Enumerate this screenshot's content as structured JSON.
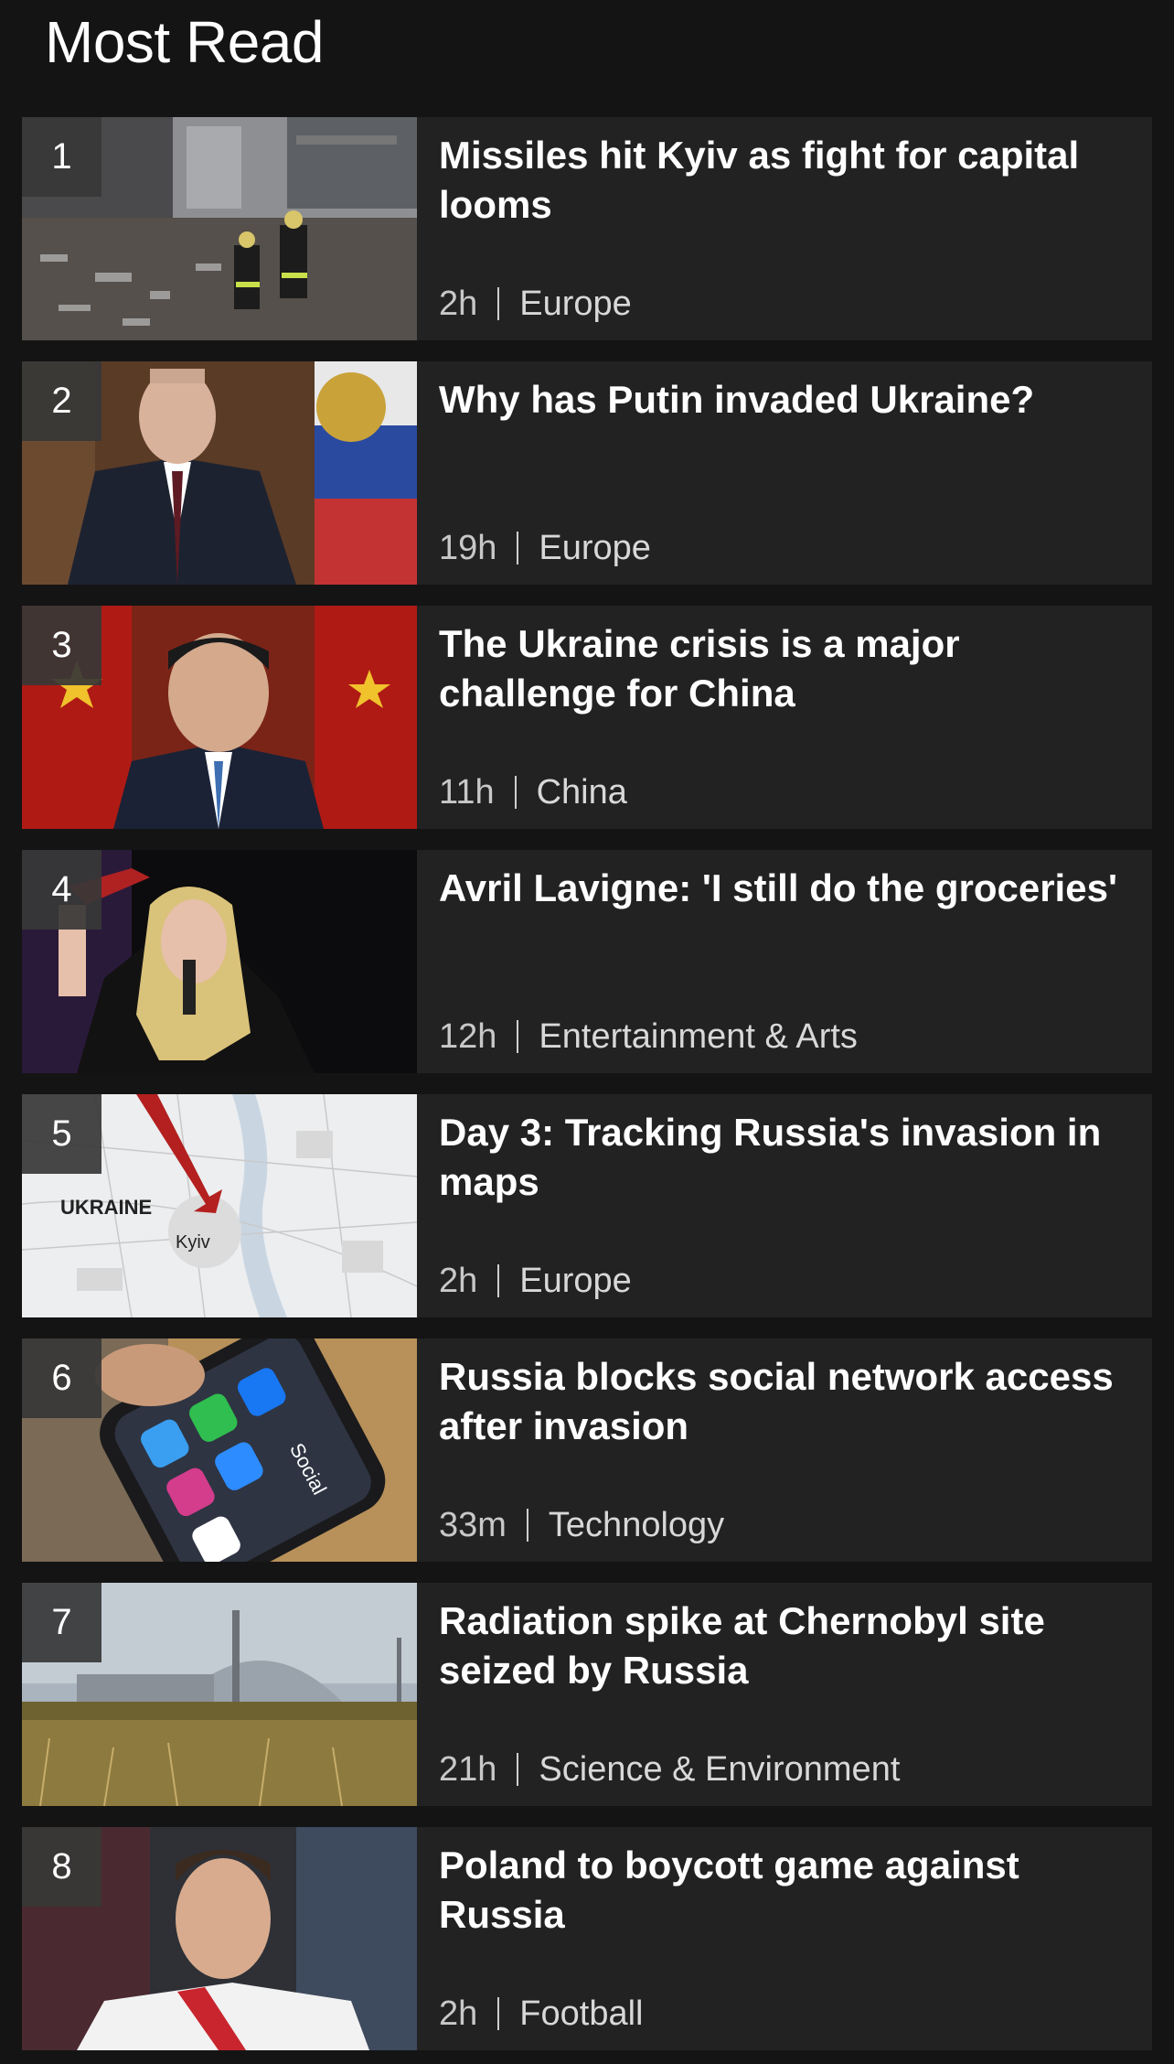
{
  "section": {
    "title": "Most Read"
  },
  "items": [
    {
      "rank": "1",
      "headline": "Missiles hit Kyiv as fight for capital looms",
      "time": "2h",
      "category": "Europe",
      "image": "firefighters-rubble"
    },
    {
      "rank": "2",
      "headline": "Why has Putin invaded Ukraine?",
      "time": "19h",
      "category": "Europe",
      "image": "putin-portrait"
    },
    {
      "rank": "3",
      "headline": "The Ukraine crisis is a major challenge for China",
      "time": "11h",
      "category": "China",
      "image": "xi-portrait"
    },
    {
      "rank": "4",
      "headline": "Avril Lavigne: 'I still do the groceries'",
      "time": "12h",
      "category": "Entertainment & Arts",
      "image": "singer-on-stage"
    },
    {
      "rank": "5",
      "headline": "Day 3: Tracking Russia's invasion in maps",
      "time": "2h",
      "category": "Europe",
      "image": "kyiv-map",
      "map_labels": {
        "country": "UKRAINE",
        "city": "Kyiv"
      }
    },
    {
      "rank": "6",
      "headline": "Russia blocks social network access after invasion",
      "time": "33m",
      "category": "Technology",
      "image": "phone-social-apps",
      "image_text": "Social"
    },
    {
      "rank": "7",
      "headline": "Radiation spike at Chernobyl site seized by Russia",
      "time": "21h",
      "category": "Science & Environment",
      "image": "chernobyl-plant"
    },
    {
      "rank": "8",
      "headline": "Poland to boycott game against Russia",
      "time": "2h",
      "category": "Football",
      "image": "footballer-portrait"
    }
  ]
}
